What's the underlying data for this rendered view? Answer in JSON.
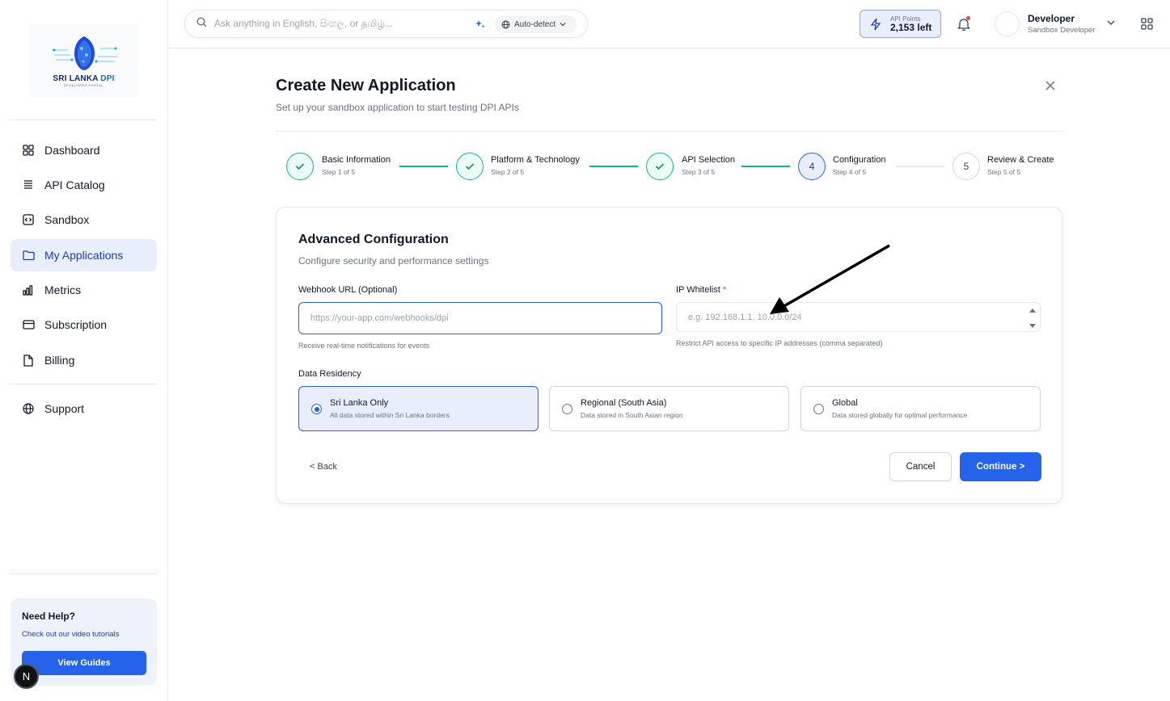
{
  "sidebar": {
    "logo": {
      "name": "SRI LANKA",
      "accent": "DPI",
      "tagline": "DEVELOPER PORTAL"
    },
    "items": [
      {
        "label": "Dashboard",
        "icon": "grid-icon"
      },
      {
        "label": "API Catalog",
        "icon": "catalog-icon"
      },
      {
        "label": "Sandbox",
        "icon": "code-box-icon"
      },
      {
        "label": "My Applications",
        "icon": "folder-icon",
        "active": true
      },
      {
        "label": "Metrics",
        "icon": "bar-chart-icon"
      },
      {
        "label": "Subscription",
        "icon": "credit-card-icon"
      },
      {
        "label": "Billing",
        "icon": "document-icon"
      },
      {
        "label": "Support",
        "icon": "globe-icon"
      }
    ],
    "help": {
      "title": "Need Help?",
      "subtitle": "Check out our video tutorials",
      "button": "View Guides"
    },
    "badge": "N"
  },
  "topbar": {
    "search_placeholder": "Ask anything in English, සිංහල, or தமிழ்...",
    "language_select": "Auto-detect",
    "api_points": {
      "label": "API Points",
      "value": "2,153 left"
    },
    "user": {
      "name": "Developer",
      "role": "Sandbox Developer"
    }
  },
  "page": {
    "title": "Create New Application",
    "subtitle": "Set up your sandbox application to start testing DPI APIs"
  },
  "steps": [
    {
      "title": "Basic Information",
      "sub": "Step 1 of 5",
      "status": "done",
      "marker": ""
    },
    {
      "title": "Platform & Technology",
      "sub": "Step 2 of 5",
      "status": "done",
      "marker": ""
    },
    {
      "title": "API Selection",
      "sub": "Step 3 of 5",
      "status": "done",
      "marker": ""
    },
    {
      "title": "Configuration",
      "sub": "Step 4 of 5",
      "status": "current",
      "marker": "4"
    },
    {
      "title": "Review & Create",
      "sub": "Step 5 of 5",
      "status": "pending",
      "marker": "5"
    }
  ],
  "form": {
    "title": "Advanced Configuration",
    "subtitle": "Configure security and performance settings",
    "webhook": {
      "label": "Webhook URL (Optional)",
      "placeholder": "https://your-app.com/webhooks/dpi",
      "help": "Receive real-time notifications for events"
    },
    "ip_whitelist": {
      "label": "IP Whitelist",
      "required_mark": "*",
      "placeholder": "e.g. 192.168.1.1, 10.0.0.0/24",
      "help": "Restrict API access to specific IP addresses (comma separated)"
    },
    "residency": {
      "label": "Data Residency",
      "options": [
        {
          "title": "Sri Lanka Only",
          "desc": "All data stored within Sri Lanka borders",
          "selected": true
        },
        {
          "title": "Regional (South Asia)",
          "desc": "Data stored in South Asian region",
          "selected": false
        },
        {
          "title": "Global",
          "desc": "Data stored globally for optimal performance",
          "selected": false
        }
      ]
    },
    "back": "< Back",
    "cancel": "Cancel",
    "continue": "Continue >"
  },
  "colors": {
    "primary": "#2563eb",
    "success": "#10b981",
    "active_bg": "#e8eefb",
    "notification": "#ef4444"
  }
}
